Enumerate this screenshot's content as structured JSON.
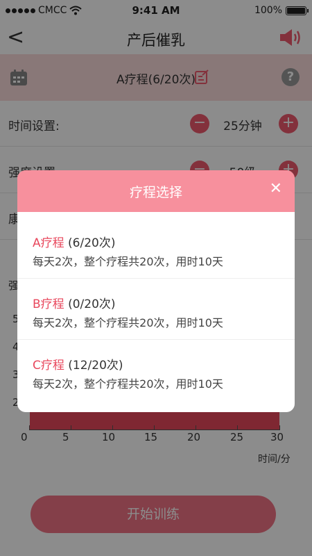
{
  "status": {
    "carrier": "CMCC",
    "time": "9:41 AM",
    "battery": "100%"
  },
  "nav": {
    "back": "<",
    "title": "产后催乳"
  },
  "course_bar": {
    "label": "A疗程(6/20次)",
    "help": "?"
  },
  "settings": {
    "time": {
      "label": "时间设置:",
      "value": "25分钟"
    },
    "intensity": {
      "label": "强度设置:",
      "value": "50级"
    },
    "health": {
      "label": "康"
    }
  },
  "controls": {
    "minus": "−",
    "plus": "+"
  },
  "chart_data": {
    "type": "area",
    "ylabel": "强",
    "xlabel": "时间/分",
    "y_ticks": [
      "5",
      "4",
      "3",
      "2"
    ],
    "x": [
      0,
      5,
      10,
      15,
      20,
      25,
      30
    ],
    "x_ticks": [
      "0",
      "5",
      "10",
      "15",
      "20",
      "25",
      "30"
    ],
    "values": [
      2,
      2,
      2,
      2,
      2,
      2,
      2
    ],
    "color": "#e8475c"
  },
  "start_button": "开始训练",
  "modal": {
    "title": "疗程选择",
    "close": "✕",
    "options": [
      {
        "name": "A疗程",
        "count": " (6/20次)",
        "desc": "每天2次，整个疗程共20次，用时10天"
      },
      {
        "name": "B疗程",
        "count": " (0/20次)",
        "desc": "每天2次，整个疗程共20次，用时10天"
      },
      {
        "name": "C疗程",
        "count": " (12/20次)",
        "desc": "每天2次，整个疗程共20次，用时10天"
      }
    ]
  },
  "colors": {
    "accent": "#e8475c",
    "modal_header": "#f7909d",
    "course_bar": "#f9dada"
  }
}
